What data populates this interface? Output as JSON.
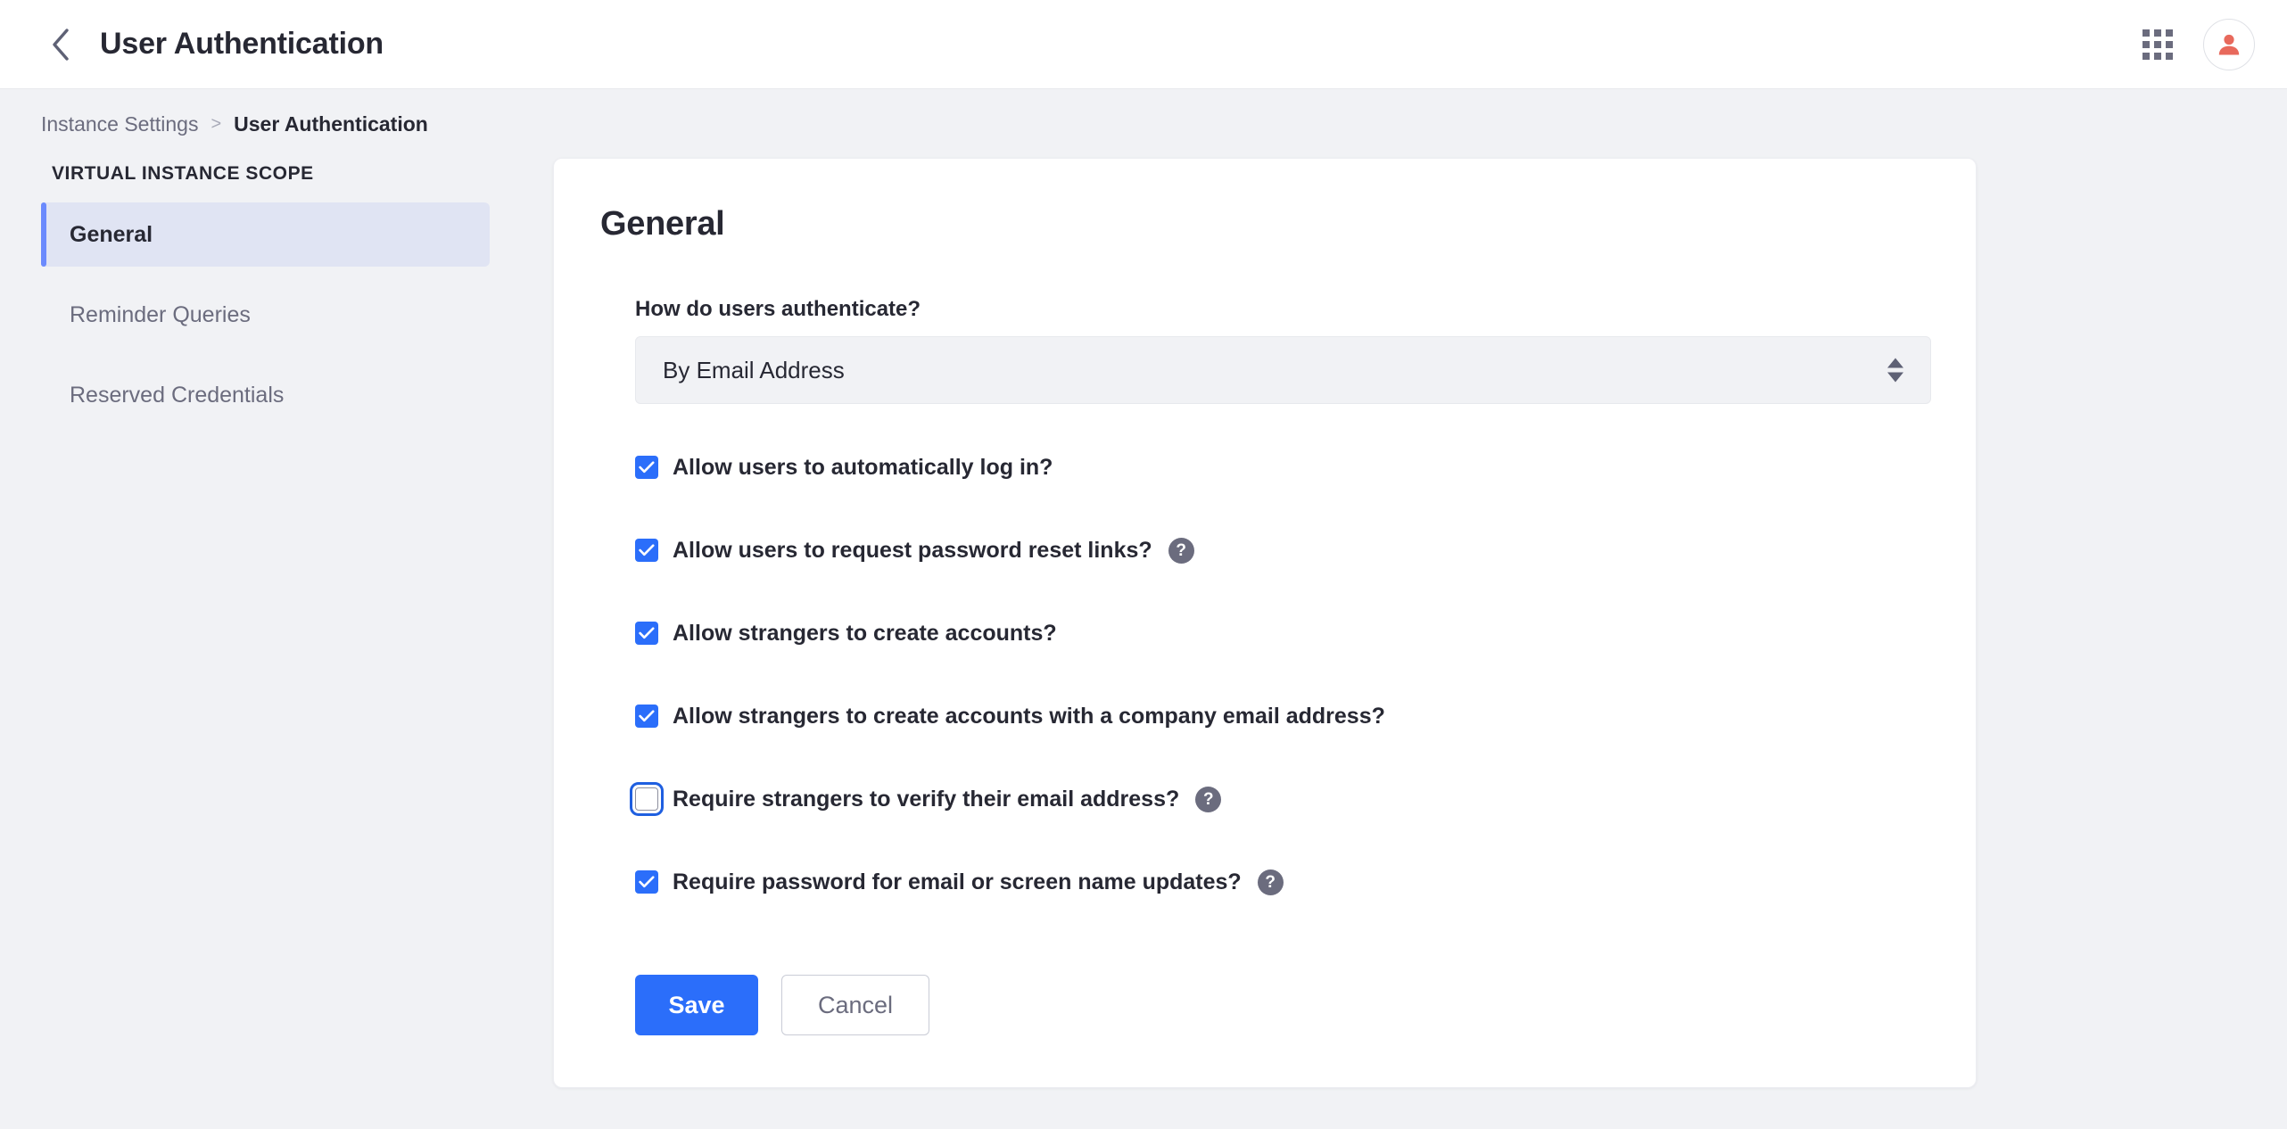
{
  "topbar": {
    "back_icon": "chevron-left-icon",
    "title": "User Authentication",
    "grid_icon": "apps-grid-icon",
    "avatar_icon": "user-avatar-icon"
  },
  "breadcrumb": {
    "parent": "Instance Settings",
    "separator": ">",
    "current": "User Authentication"
  },
  "sidebar": {
    "heading": "VIRTUAL INSTANCE SCOPE",
    "items": [
      {
        "label": "General",
        "active": true
      },
      {
        "label": "Reminder Queries",
        "active": false
      },
      {
        "label": "Reserved Credentials",
        "active": false
      }
    ]
  },
  "card": {
    "title": "General",
    "select_field": {
      "label": "How do users authenticate?",
      "value": "By Email Address",
      "options": [
        "By Email Address"
      ],
      "arrows_icon": "sort-arrows-icon"
    },
    "checkboxes": [
      {
        "label": "Allow users to automatically log in?",
        "checked": true,
        "help": false
      },
      {
        "label": "Allow users to request password reset links?",
        "checked": true,
        "help": true
      },
      {
        "label": "Allow strangers to create accounts?",
        "checked": true,
        "help": false
      },
      {
        "label": "Allow strangers to create accounts with a company email address?",
        "checked": true,
        "help": false
      },
      {
        "label": "Require strangers to verify their email address?",
        "checked": false,
        "help": true,
        "focused": true
      },
      {
        "label": "Require password for email or screen name updates?",
        "checked": true,
        "help": true
      }
    ],
    "help_glyph": "?",
    "buttons": {
      "save": "Save",
      "cancel": "Cancel"
    }
  },
  "colors": {
    "accent_blue": "#2b6efa",
    "active_nav_bg": "#e0e4f3",
    "active_nav_bar": "#6b8afd",
    "page_bg": "#f1f2f5",
    "text_dark": "#272833",
    "text_muted": "#6b6c7e",
    "avatar_person": "#e8695c"
  }
}
